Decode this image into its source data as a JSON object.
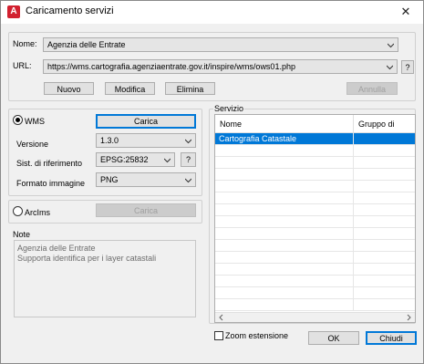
{
  "window": {
    "title": "Caricamento servizi",
    "app_icon_letter": "A",
    "accent": "#d2202f",
    "close_glyph": "✕"
  },
  "top": {
    "name_label": "Nome:",
    "name_value": "Agenzia delle Entrate",
    "url_label": "URL:",
    "url_value": "https://wms.cartografia.agenziaentrate.gov.it/inspire/wms/ows01.php",
    "help_label": "?",
    "buttons": {
      "new": "Nuovo",
      "edit": "Modifica",
      "delete": "Elimina",
      "cancel": "Annulla"
    }
  },
  "wms": {
    "radio_label": "WMS",
    "selected": true,
    "load_button": "Carica",
    "version_label": "Versione",
    "version_value": "1.3.0",
    "crs_label": "Sist. di riferimento",
    "crs_value": "EPSG:25832",
    "crs_help": "?",
    "format_label": "Formato immagine",
    "format_value": "PNG"
  },
  "arcims": {
    "radio_label": "ArcIms",
    "selected": false,
    "load_button": "Carica"
  },
  "note": {
    "label": "Note",
    "line1": "Agenzia delle Entrate",
    "line2": "Supporta identifica per i layer catastali"
  },
  "service": {
    "label": "Servizio",
    "columns": [
      "Nome",
      "Gruppo di servizi"
    ],
    "rows": [
      {
        "name": "Cartografia Catastale",
        "group": "",
        "selected": true
      }
    ],
    "selection_color": "#0078d7"
  },
  "footer": {
    "zoom_label": "Zoom estensione",
    "zoom_checked": false,
    "ok": "OK",
    "close": "Chiudi"
  }
}
